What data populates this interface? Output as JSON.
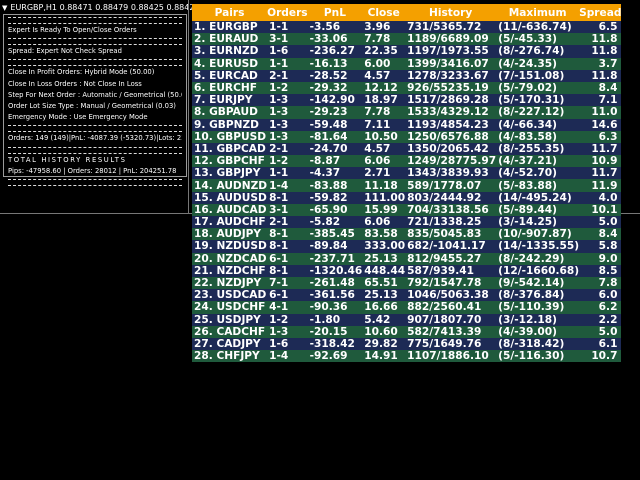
{
  "symbol_bar": {
    "text": "EURGBP,H1  0.88471 0.88479 0.88425 0.88425"
  },
  "panel": {
    "status": "Expert Is Ready To Open/Close Orders",
    "spread": "Spread: Expert Not Check Spread",
    "settings": [
      "Close In Profit Orders: Hybrid Mode (50.00)",
      "Close In Loss Orders  : Not Close In Loss",
      "Step For Next Order  : Automatic / Geometrical (50.0)",
      "Order Lot Size Type  : Manual / Geometrical (0.03)",
      "Emergency Mode       : Use Emergency Mode"
    ],
    "orders": "Orders: 149 (149)|PnL: -4087.39 (-5320.73)|Lots: 23.10",
    "history_title": "TOTAL HISTORY RESULTS",
    "history": "Pips: -47958.60 | Orders: 28012 | PnL: 204251.78"
  },
  "table": {
    "headers": [
      "Pairs",
      "Orders",
      "PnL",
      "Close",
      "History",
      "Maximum",
      "Spread"
    ],
    "rows": [
      [
        "1. EURGBP",
        "1-1",
        "-3.56",
        "3.96",
        "731/5365.72",
        "(11/-636.74)",
        "6.5"
      ],
      [
        "2. EURAUD",
        "3-1",
        "-33.06",
        "7.78",
        "1189/6689.09",
        "(5/-45.33)",
        "11.8"
      ],
      [
        "3. EURNZD",
        "1-6",
        "-236.27",
        "22.35",
        "1197/1973.55",
        "(8/-276.74)",
        "11.8"
      ],
      [
        "4. EURUSD",
        "1-1",
        "-16.13",
        "6.00",
        "1399/3416.07",
        "(4/-24.35)",
        "3.7"
      ],
      [
        "5. EURCAD",
        "2-1",
        "-28.52",
        "4.57",
        "1278/3233.67",
        "(7/-151.08)",
        "11.8"
      ],
      [
        "6. EURCHF",
        "1-2",
        "-29.32",
        "12.12",
        "926/55235.19",
        "(5/-79.02)",
        "8.4"
      ],
      [
        "7. EURJPY",
        "1-3",
        "-142.90",
        "18.97",
        "1517/2869.28",
        "(5/-170.31)",
        "7.1"
      ],
      [
        "8. GBPAUD",
        "1-3",
        "-29.23",
        "7.78",
        "1533/4329.12",
        "(8/-227.12)",
        "11.0"
      ],
      [
        "9. GBPNZD",
        "1-3",
        "-59.48",
        "7.11",
        "1193/4854.23",
        "(4/-66.34)",
        "14.6"
      ],
      [
        "10. GBPUSD",
        "1-3",
        "-81.64",
        "10.50",
        "1250/6576.88",
        "(4/-83.58)",
        "6.3"
      ],
      [
        "11. GBPCAD",
        "2-1",
        "-24.70",
        "4.57",
        "1350/2065.42",
        "(8/-255.35)",
        "11.7"
      ],
      [
        "12. GBPCHF",
        "1-2",
        "-8.87",
        "6.06",
        "1249/28775.97",
        "(4/-37.21)",
        "10.9"
      ],
      [
        "13. GBPJPY",
        "1-1",
        "-4.37",
        "2.71",
        "1343/3839.93",
        "(4/-52.70)",
        "11.7"
      ],
      [
        "14. AUDNZD",
        "1-4",
        "-83.88",
        "11.18",
        "589/1778.07",
        "(5/-83.88)",
        "11.9"
      ],
      [
        "15. AUDUSD",
        "8-1",
        "-59.82",
        "111.00",
        "803/2444.92",
        "(14/-495.24)",
        "4.0"
      ],
      [
        "16. AUDCAD",
        "3-1",
        "-65.90",
        "15.99",
        "704/33138.56",
        "(5/-89.44)",
        "10.1"
      ],
      [
        "17. AUDCHF",
        "2-1",
        "-5.82",
        "6.06",
        "721/1338.25",
        "(3/-14.25)",
        "5.0"
      ],
      [
        "18. AUDJPY",
        "8-1",
        "-385.45",
        "83.58",
        "835/5045.83",
        "(10/-907.87)",
        "8.4"
      ],
      [
        "19. NZDUSD",
        "8-1",
        "-89.84",
        "333.00",
        "682/-1041.17",
        "(14/-1335.55)",
        "5.8"
      ],
      [
        "20. NZDCAD",
        "6-1",
        "-237.71",
        "25.13",
        "812/9455.27",
        "(8/-242.29)",
        "9.0"
      ],
      [
        "21. NZDCHF",
        "8-1",
        "-1320.46",
        "448.44",
        "587/939.41",
        "(12/-1660.68)",
        "8.5"
      ],
      [
        "22. NZDJPY",
        "7-1",
        "-261.48",
        "65.51",
        "792/1547.78",
        "(9/-542.14)",
        "7.8"
      ],
      [
        "23. USDCAD",
        "6-1",
        "-361.56",
        "25.13",
        "1046/5063.38",
        "(8/-376.84)",
        "6.0"
      ],
      [
        "24. USDCHF",
        "4-1",
        "-90.36",
        "16.66",
        "882/2560.41",
        "(5/-110.39)",
        "6.2"
      ],
      [
        "25. USDJPY",
        "1-2",
        "-1.80",
        "5.42",
        "907/1807.70",
        "(3/-12.18)",
        "2.2"
      ],
      [
        "26. CADCHF",
        "1-3",
        "-20.15",
        "10.60",
        "582/7413.39",
        "(4/-39.00)",
        "5.0"
      ],
      [
        "27. CADJPY",
        "1-6",
        "-318.42",
        "29.82",
        "775/1649.76",
        "(8/-318.42)",
        "6.1"
      ],
      [
        "28. CHFJPY",
        "1-4",
        "-92.69",
        "14.91",
        "1107/1886.10",
        "(5/-116.30)",
        "10.7"
      ]
    ]
  },
  "colors": {
    "header": "#f4a000",
    "row_odd": "#1d2a55",
    "row_even": "#1f5a3c"
  }
}
